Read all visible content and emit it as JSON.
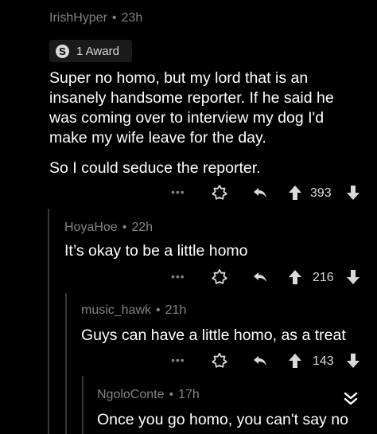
{
  "comments": [
    {
      "author": "IrishHyper",
      "age": "23h",
      "award": "1 Award",
      "award_coin": "S",
      "body": [
        "Super no homo, but my lord that is an",
        "insanely handsome reporter. If he said he",
        "was coming over to interview my dog I'd",
        "make my wife leave for the day."
      ],
      "body2": "So I could seduce the reporter.",
      "score": "393"
    },
    {
      "author": "HoyaHoe",
      "age": "22h",
      "body": "It’s okay to be a little homo",
      "score": "216"
    },
    {
      "author": "music_hawk",
      "age": "21h",
      "body": "Guys can have a little homo, as a treat",
      "score": "143"
    },
    {
      "author": "NgoloConte",
      "age": "17h",
      "body": "Once you go homo, you can't say no"
    }
  ],
  "ui": {
    "separator": "•",
    "more": "•••",
    "colors": {
      "background": "#000000",
      "text": "#ffffff",
      "meta": "#818384",
      "thread": "#343536"
    }
  }
}
